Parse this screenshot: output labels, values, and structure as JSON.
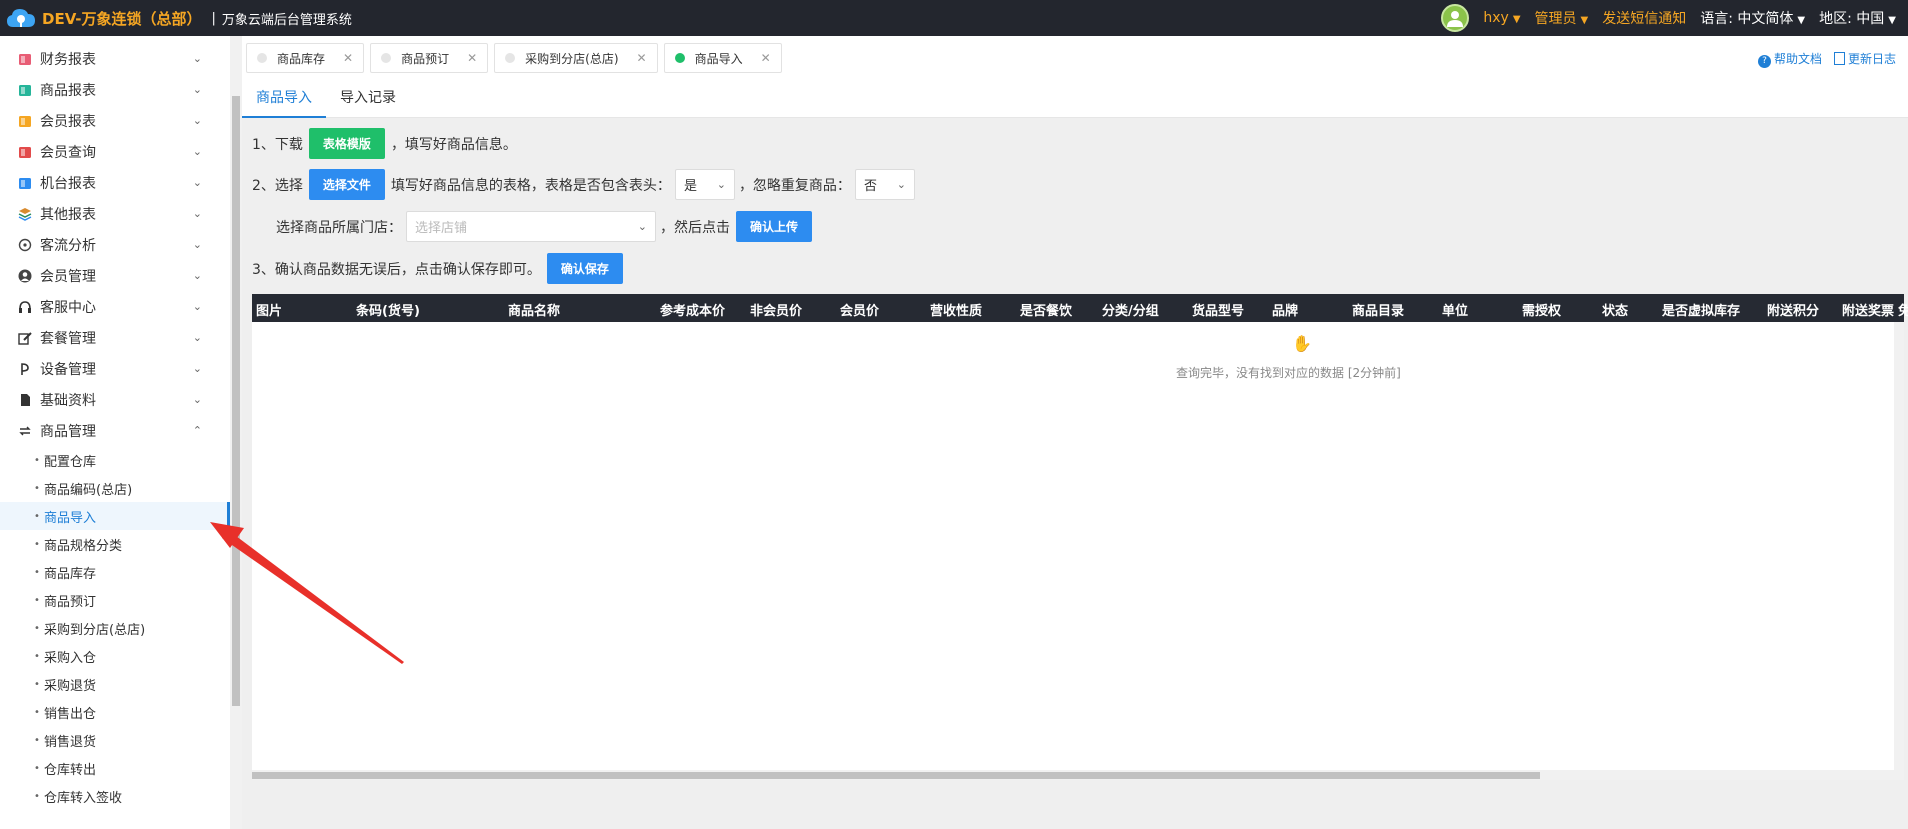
{
  "header": {
    "brand": "DEV-万象连锁（总部）",
    "separator": "|",
    "system_name": "万象云端后台管理系统",
    "user": "hxy",
    "role": "管理员",
    "notify": "发送短信通知",
    "language_label": "语言:",
    "language_value": "中文简体",
    "region_label": "地区:",
    "region_value": "中国"
  },
  "sidebar": {
    "items": [
      {
        "label": "财务报表",
        "icon": "finance-report-icon",
        "color": "#e85d75"
      },
      {
        "label": "商品报表",
        "icon": "goods-report-icon",
        "color": "#26b59a"
      },
      {
        "label": "会员报表",
        "icon": "member-report-icon",
        "color": "#f5a623"
      },
      {
        "label": "会员查询",
        "icon": "member-query-icon",
        "color": "#e24b4b"
      },
      {
        "label": "机台报表",
        "icon": "machine-report-icon",
        "color": "#2d8cf0"
      },
      {
        "label": "其他报表",
        "icon": "layers-icon",
        "color": "#d88a2e"
      },
      {
        "label": "客流分析",
        "icon": "target-icon",
        "color": "#555555"
      },
      {
        "label": "会员管理",
        "icon": "user-icon",
        "color": "#555555"
      },
      {
        "label": "客服中心",
        "icon": "headset-icon",
        "color": "#333333"
      },
      {
        "label": "套餐管理",
        "icon": "edit-icon",
        "color": "#333333"
      },
      {
        "label": "设备管理",
        "icon": "device-icon",
        "color": "#333333"
      },
      {
        "label": "基础资料",
        "icon": "document-icon",
        "color": "#333333"
      }
    ],
    "expanded": {
      "label": "商品管理",
      "icon": "swap-icon"
    },
    "sub_items": [
      {
        "label": "配置仓库",
        "active": false
      },
      {
        "label": "商品编码(总店)",
        "active": false
      },
      {
        "label": "商品导入",
        "active": true
      },
      {
        "label": "商品规格分类",
        "active": false
      },
      {
        "label": "商品库存",
        "active": false
      },
      {
        "label": "商品预订",
        "active": false
      },
      {
        "label": "采购到分店(总店)",
        "active": false
      },
      {
        "label": "采购入仓",
        "active": false
      },
      {
        "label": "采购退货",
        "active": false
      },
      {
        "label": "销售出仓",
        "active": false
      },
      {
        "label": "销售退货",
        "active": false
      },
      {
        "label": "仓库转出",
        "active": false
      },
      {
        "label": "仓库转入签收",
        "active": false
      }
    ]
  },
  "tabs": [
    {
      "label": "商品库存",
      "active": false
    },
    {
      "label": "商品预订",
      "active": false
    },
    {
      "label": "采购到分店(总店)",
      "active": false
    },
    {
      "label": "商品导入",
      "active": true
    }
  ],
  "help": {
    "help_doc": "帮助文档",
    "changelog": "更新日志"
  },
  "subtabs": [
    "商品导入",
    "导入记录"
  ],
  "steps": {
    "step1_prefix": "1、下载",
    "template_button": "表格模版",
    "step1_suffix": "，填写好商品信息。",
    "step2_prefix": "2、选择",
    "choose_file_button": "选择文件",
    "step2_text": "填写好商品信息的表格，表格是否包含表头：",
    "has_header_value": "是",
    "ignore_dup_label": "，忽略重复商品：",
    "ignore_dup_value": "否",
    "store_label": "选择商品所属门店：",
    "store_placeholder": "选择店铺",
    "then_click": "，然后点击",
    "upload_button": "确认上传",
    "step3_text": "3、确认商品数据无误后，点击确认保存即可。",
    "save_button": "确认保存"
  },
  "table": {
    "columns": [
      "图片",
      "条码(货号)",
      "商品名称",
      "参考成本价",
      "非会员价",
      "会员价",
      "营收性质",
      "是否餐饮",
      "分类/分组",
      "货品型号",
      "品牌",
      "商品目录",
      "单位",
      "需授权",
      "状态",
      "是否虚拟库存",
      "附送积分",
      "附送奖票",
      "免"
    ],
    "empty_message": "查询完毕，没有找到对应的数据 [2分钟前]"
  },
  "colors": {
    "accent": "#1f7fd6",
    "green": "#1fbf6a",
    "blue": "#2d8cf0",
    "topbar": "#23262e",
    "brand": "#f5a623"
  }
}
